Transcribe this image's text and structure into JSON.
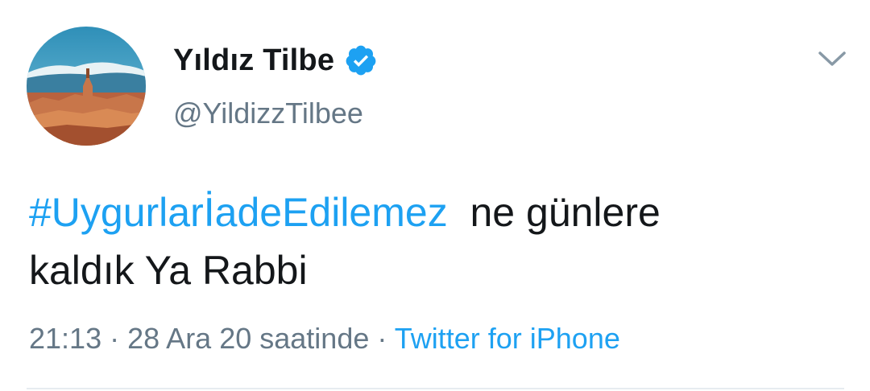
{
  "tweet": {
    "author": {
      "display_name": "Yıldız Tilbe",
      "handle": "@YildizzTilbee",
      "verified": true,
      "avatar_icon": "avatar-landscape-fortress"
    },
    "menu_icon": "chevron-down-icon",
    "text": {
      "hashtag": "#UygurlarİadeEdilemez",
      "body_line1": "ne günlere",
      "body_line2": "kaldık Ya Rabbi"
    },
    "meta": {
      "time": "21:13",
      "separator1": "·",
      "date": "28 Ara 20 saatinde",
      "separator2": "·",
      "source": "Twitter for iPhone"
    }
  },
  "colors": {
    "link": "#1da1f2",
    "text": "#14171a",
    "secondary": "#657786",
    "divider": "#e6ecf0"
  }
}
